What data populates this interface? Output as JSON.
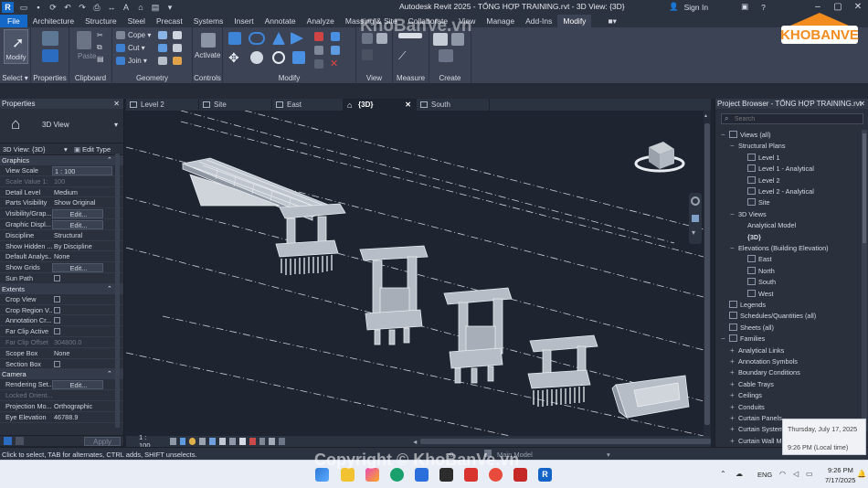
{
  "titlebar": {
    "app_icon": "R",
    "title": "Autodesk Revit 2025 - TỔNG HỢP TRAINING.rvt - 3D View: {3D}",
    "sign_in": "Sign In",
    "help": "?"
  },
  "ribbon_tabs": [
    "File",
    "Architecture",
    "Structure",
    "Steel",
    "Precast",
    "Systems",
    "Insert",
    "Annotate",
    "Analyze",
    "Massing & Site",
    "Collaborate",
    "View",
    "Manage",
    "Add-Ins",
    "Modify"
  ],
  "active_tab": "Modify",
  "ribbon": {
    "select": {
      "label": "Modify",
      "group": "Select"
    },
    "properties_group": "Properties",
    "clipboard": {
      "paste": "Paste",
      "group": "Clipboard"
    },
    "geometry": {
      "cope": "Cope",
      "cut": "Cut",
      "join": "Join",
      "group": "Geometry"
    },
    "controls": {
      "activate": "Activate",
      "group": "Controls"
    },
    "modify_group": "Modify",
    "view_group": "View",
    "measure_group": "Measure",
    "create_group": "Create"
  },
  "properties": {
    "title": "Properties",
    "type_name": "3D View",
    "selector": "3D View: {3D}",
    "edit_type": "Edit Type",
    "apply": "Apply",
    "groups": [
      {
        "name": "Graphics",
        "rows": [
          {
            "k": "View Scale",
            "v": "1 : 100",
            "kind": "box"
          },
          {
            "k": "Scale Value    1:",
            "v": "100",
            "kind": "dim"
          },
          {
            "k": "Detail Level",
            "v": "Medium",
            "kind": "text"
          },
          {
            "k": "Parts Visibility",
            "v": "Show Original",
            "kind": "text"
          },
          {
            "k": "Visibility/Grap...",
            "v": "Edit...",
            "kind": "btn"
          },
          {
            "k": "Graphic Displ...",
            "v": "Edit...",
            "kind": "btn"
          },
          {
            "k": "Discipline",
            "v": "Structural",
            "kind": "text"
          },
          {
            "k": "Show Hidden ...",
            "v": "By Discipline",
            "kind": "text"
          },
          {
            "k": "Default Analys...",
            "v": "None",
            "kind": "text"
          },
          {
            "k": "Show Grids",
            "v": "Edit...",
            "kind": "btn"
          },
          {
            "k": "Sun Path",
            "v": "",
            "kind": "check"
          }
        ]
      },
      {
        "name": "Extents",
        "rows": [
          {
            "k": "Crop View",
            "v": "",
            "kind": "check"
          },
          {
            "k": "Crop Region V...",
            "v": "",
            "kind": "check"
          },
          {
            "k": "Annotation Cr...",
            "v": "",
            "kind": "check"
          },
          {
            "k": "Far Clip Active",
            "v": "",
            "kind": "check"
          },
          {
            "k": "Far Clip Offset",
            "v": "304800.0",
            "kind": "dim"
          },
          {
            "k": "Scope Box",
            "v": "None",
            "kind": "text"
          },
          {
            "k": "Section Box",
            "v": "",
            "kind": "check"
          }
        ]
      },
      {
        "name": "Camera",
        "rows": [
          {
            "k": "Rendering Set...",
            "v": "Edit...",
            "kind": "btn"
          },
          {
            "k": "Locked Orient...",
            "v": "",
            "kind": "dimk"
          },
          {
            "k": "Projection Mo...",
            "v": "Orthographic",
            "kind": "text"
          },
          {
            "k": "Eye Elevation",
            "v": "46788.9",
            "kind": "text"
          }
        ]
      }
    ]
  },
  "view_tabs": [
    {
      "label": "Level 2",
      "active": false
    },
    {
      "label": "Site",
      "active": false
    },
    {
      "label": "East",
      "active": false
    },
    {
      "label": "{3D}",
      "active": true
    },
    {
      "label": "South",
      "active": false
    }
  ],
  "view_control": {
    "scale": "1 : 100"
  },
  "project_browser": {
    "title": "Project Browser - TỔNG HỢP TRAINING.rvt",
    "search_placeholder": "Search",
    "items": [
      {
        "label": "Views (all)",
        "level": 0,
        "tw": "−",
        "icon": true
      },
      {
        "label": "Structural Plans",
        "level": 1,
        "tw": "−",
        "icon": false
      },
      {
        "label": "Level 1",
        "level": 2,
        "tw": "",
        "icon": true
      },
      {
        "label": "Level 1 - Analytical",
        "level": 2,
        "tw": "",
        "icon": true
      },
      {
        "label": "Level 2",
        "level": 2,
        "tw": "",
        "icon": true
      },
      {
        "label": "Level 2 - Analytical",
        "level": 2,
        "tw": "",
        "icon": true
      },
      {
        "label": "Site",
        "level": 2,
        "tw": "",
        "icon": true
      },
      {
        "label": "3D Views",
        "level": 1,
        "tw": "−",
        "icon": false
      },
      {
        "label": "Analytical Model",
        "level": 2,
        "tw": "",
        "icon": false
      },
      {
        "label": "{3D}",
        "level": 2,
        "tw": "",
        "icon": false,
        "bold": true
      },
      {
        "label": "Elevations (Building Elevation)",
        "level": 1,
        "tw": "−",
        "icon": false
      },
      {
        "label": "East",
        "level": 2,
        "tw": "",
        "icon": true
      },
      {
        "label": "North",
        "level": 2,
        "tw": "",
        "icon": true
      },
      {
        "label": "South",
        "level": 2,
        "tw": "",
        "icon": true
      },
      {
        "label": "West",
        "level": 2,
        "tw": "",
        "icon": true
      },
      {
        "label": "Legends",
        "level": 0,
        "tw": "",
        "icon": true
      },
      {
        "label": "Schedules/Quantities (all)",
        "level": 0,
        "tw": "",
        "icon": true
      },
      {
        "label": "Sheets (all)",
        "level": 0,
        "tw": "",
        "icon": true
      },
      {
        "label": "Families",
        "level": 0,
        "tw": "−",
        "icon": true
      },
      {
        "label": "Analytical Links",
        "level": 1,
        "tw": "+",
        "icon": false
      },
      {
        "label": "Annotation Symbols",
        "level": 1,
        "tw": "+",
        "icon": false
      },
      {
        "label": "Boundary Conditions",
        "level": 1,
        "tw": "+",
        "icon": false
      },
      {
        "label": "Cable Trays",
        "level": 1,
        "tw": "+",
        "icon": false
      },
      {
        "label": "Ceilings",
        "level": 1,
        "tw": "+",
        "icon": false
      },
      {
        "label": "Conduits",
        "level": 1,
        "tw": "+",
        "icon": false
      },
      {
        "label": "Curtain Panels",
        "level": 1,
        "tw": "+",
        "icon": false
      },
      {
        "label": "Curtain Systems",
        "level": 1,
        "tw": "+",
        "icon": false
      },
      {
        "label": "Curtain Wall Mullions",
        "level": 1,
        "tw": "+",
        "icon": false
      }
    ]
  },
  "status": {
    "text": "Click to select, TAB for alternates, CTRL adds, SHIFT unselects.",
    "model": "Main Model",
    "workset_count": ":0"
  },
  "notification": {
    "date": "Thursday, July 17, 2025",
    "time_local": "9:26 PM (Local time)"
  },
  "taskbar": {
    "lang": "ENG",
    "time": "9:26 PM",
    "date": "7/17/2025"
  },
  "watermarks": {
    "top": "KhoBanVe.vn",
    "copyright": "Copyright © KhoBanVe.vn",
    "logo": "KHOBANVE"
  },
  "colors": {
    "accent": "#1468c8",
    "canvas": "#1e2430",
    "panel": "#2a303c",
    "logo_orange": "#f28c1e"
  }
}
